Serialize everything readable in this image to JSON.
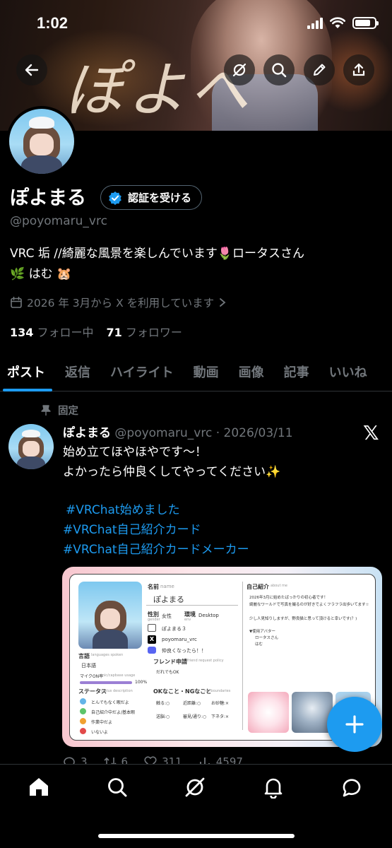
{
  "status_bar": {
    "time": "1:02"
  },
  "banner": {
    "handwriting": "ぽよへ"
  },
  "profile": {
    "name": "ぽよまる",
    "verify_label": "認証を受ける",
    "handle": "@poyomaru_vrc",
    "bio_line1": "VRC 垢 //綺麗な風景を楽しんでいます🌷ロータスさん",
    "bio_line2": "🌿 はむ 🐹",
    "joined": "2026 年 3月から X を利用しています",
    "following_count": "134",
    "following_label": "フォロー中",
    "followers_count": "71",
    "followers_label": "フォロワー"
  },
  "tabs": [
    {
      "label": "ポスト",
      "active": true
    },
    {
      "label": "返信"
    },
    {
      "label": "ハイライト"
    },
    {
      "label": "動画"
    },
    {
      "label": "画像"
    },
    {
      "label": "記事"
    },
    {
      "label": "いいね"
    }
  ],
  "post": {
    "pinned_label": "固定",
    "author_name": "ぽよまる",
    "author_meta": "@poyomaru_vrc · 2026/03/11",
    "text_line1": "始め立てほやほやです〜！",
    "text_line2": "よかったら仲良くしてやってください✨",
    "hashtags": [
      "#VRChat始めました",
      "#VRChat自己紹介カード",
      "#VRChat自己紹介カードメーカー"
    ],
    "card": {
      "name_label": "名前",
      "name_sub": "name",
      "name_value": "ぽよまる",
      "gender_label": "性別",
      "gender_sub": "gender",
      "gender_value": "女性",
      "env_label": "環境",
      "env_sub": "env",
      "env_value": "Desktop",
      "vrc_name": "ぽよまる３",
      "x_handle": "poyomaru_vrc",
      "discord_text": "仲良くなったら！！",
      "friend_label": "フレンド申請",
      "friend_sub": "friend request policy",
      "friend_value": "だれでもOK",
      "ng_label": "OKなこと・NGなこと",
      "ng_sub": "my boundaries",
      "ng_items": [
        "触る:○",
        "近距離:○",
        "お砂糖:×",
        "送脳:○",
        "審見/通り:○",
        "下ネタ:×"
      ],
      "intro_label": "自己紹介",
      "intro_sub": "about me",
      "intro_text1": "2026年3月に始めたばっかりの初心者です！",
      "intro_text2": "綺麗なワールドで写真を撮るのが好きでよくフラフラ出歩いてます☆",
      "intro_text3": "少し人見知りしますが、野良猫と思って頂けると幸いです(？)",
      "avatar_label": "▼使用アバター",
      "avatar1": "ロータスさん",
      "avatar2": "はむ",
      "lang_label": "言語",
      "lang_sub": "languages spoken",
      "lang_value": "日本語",
      "mic_label": "マイクON率",
      "mic_sub": "mic/capbase usage",
      "mic_value": "100%",
      "status_label": "ステータス",
      "status_sub": "status description",
      "statuses": [
        "とんでもなく暇だよ",
        "自己紹介中だよ/基本暇",
        "作業中だよ",
        "いないよ"
      ]
    },
    "actions": {
      "replies": "3",
      "reposts": "6",
      "likes": "311",
      "views": "4597"
    }
  },
  "colors": {
    "accent": "#1d9bf0",
    "muted": "#71767b",
    "background": "#000000"
  }
}
